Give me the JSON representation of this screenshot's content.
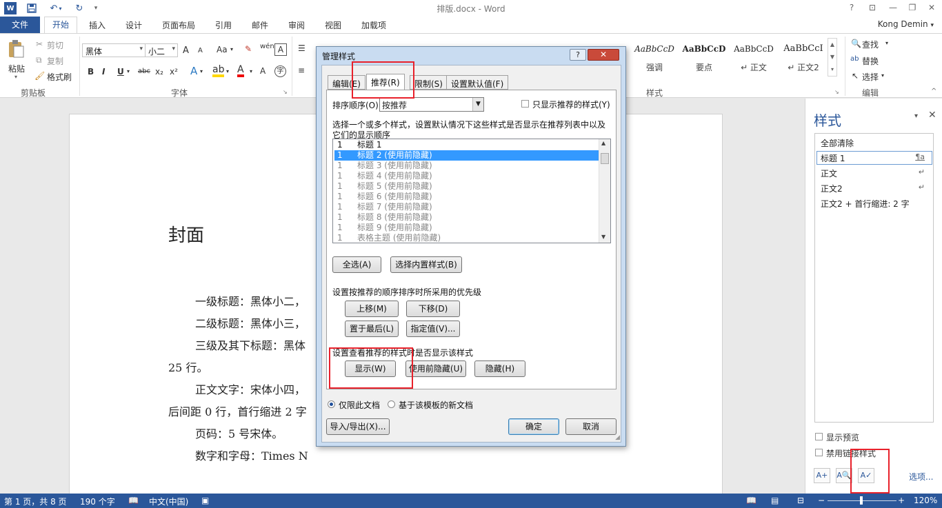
{
  "window": {
    "title": "排版.docx - Word",
    "help": "?",
    "user": "Kong Demin"
  },
  "ribbon": {
    "file_tab": "文件",
    "tabs": [
      "开始",
      "插入",
      "设计",
      "页面布局",
      "引用",
      "邮件",
      "审阅",
      "视图",
      "加载项"
    ],
    "clipboard": {
      "paste": "粘贴",
      "cut": "剪切",
      "copy": "复制",
      "format_painter": "格式刷",
      "label": "剪贴板"
    },
    "font": {
      "name": "黑体",
      "size": "小二",
      "label": "字体",
      "grow": "A",
      "shrink": "A",
      "case": "Aa",
      "bold": "B",
      "italic": "I",
      "underline": "U",
      "strike": "abc",
      "subscript": "x₂",
      "superscript": "x²"
    },
    "styles_gallery": [
      {
        "preview": "AaBbCcD",
        "name": "强调"
      },
      {
        "preview": "AaBbCcD",
        "name": "要点"
      },
      {
        "preview": "AaBbCcD",
        "name": "↵ 正文"
      },
      {
        "preview": "AaBbCcI",
        "name": "↵ 正文2"
      }
    ],
    "styles_label": "样式",
    "editing": {
      "find": "查找",
      "replace": "替换",
      "select": "选择",
      "label": "编辑"
    }
  },
  "document": {
    "heading": "封面",
    "lines": [
      "一级标题：黑体小二，",
      "二级标题：黑体小三，",
      "三级及其下标题：黑体",
      "25 行。",
      "正文文字：宋体小四，",
      "后间距 0 行，首行缩进 2 字",
      "页码：5 号宋体。",
      "数字和字母：Times N"
    ]
  },
  "styles_pane": {
    "title": "样式",
    "items": [
      {
        "label": "全部清除",
        "mark": ""
      },
      {
        "label": "标题 1",
        "mark": "¶a"
      },
      {
        "label": "正文",
        "mark": "↵"
      },
      {
        "label": "正文2",
        "mark": "↵"
      },
      {
        "label": "正文2 + 首行缩进:  2 字",
        "mark": ""
      }
    ],
    "show_preview": "显示预览",
    "disable_linked": "禁用链接样式",
    "options": "选项..."
  },
  "status_bar": {
    "page": "第 1 页，共 8 页",
    "words": "190 个字",
    "language": "中文(中国)",
    "zoom": "120%"
  },
  "dialog": {
    "title": "管理样式",
    "tabs": [
      "编辑(E)",
      "推荐(R)",
      "限制(S)",
      "设置默认值(F)"
    ],
    "active_tab": "推荐(R)",
    "sort_label": "排序顺序(O):",
    "sort_value": "按推荐",
    "only_recommended": "只显示推荐的样式(Y)",
    "instructions": [
      "选择一个或多个样式，设置默认情况下这些样式是否显示在推荐列表中以及",
      "它们的显示顺序"
    ],
    "style_list": [
      {
        "priority": "1",
        "name": "标题 1"
      },
      {
        "priority": "1",
        "name": "标题 2  (使用前隐藏)"
      },
      {
        "priority": "1",
        "name": "标题 3  (使用前隐藏)"
      },
      {
        "priority": "1",
        "name": "标题 4  (使用前隐藏)"
      },
      {
        "priority": "1",
        "name": "标题 5  (使用前隐藏)"
      },
      {
        "priority": "1",
        "name": "标题 6  (使用前隐藏)"
      },
      {
        "priority": "1",
        "name": "标题 7  (使用前隐藏)"
      },
      {
        "priority": "1",
        "name": "标题 8  (使用前隐藏)"
      },
      {
        "priority": "1",
        "name": "标题 9  (使用前隐藏)"
      },
      {
        "priority": "1",
        "name": "表格主题  (使用前隐藏)"
      }
    ],
    "selected_index": 1,
    "select_all": "全选(A)",
    "select_builtin": "选择内置样式(B)",
    "priority_label": "设置按推荐的顺序排序时所采用的优先级",
    "move_up": "上移(M)",
    "move_down": "下移(D)",
    "make_last": "置于最后(L)",
    "assign_value": "指定值(V)...",
    "visibility_label": "设置查看推荐的样式时是否显示该样式",
    "show": "显示(W)",
    "hide_until_used": "使用前隐藏(U)",
    "hide": "隐藏(H)",
    "only_this_doc": "仅限此文档",
    "new_docs_template": "基于该模板的新文档",
    "import_export": "导入/导出(X)...",
    "ok": "确定",
    "cancel": "取消"
  }
}
